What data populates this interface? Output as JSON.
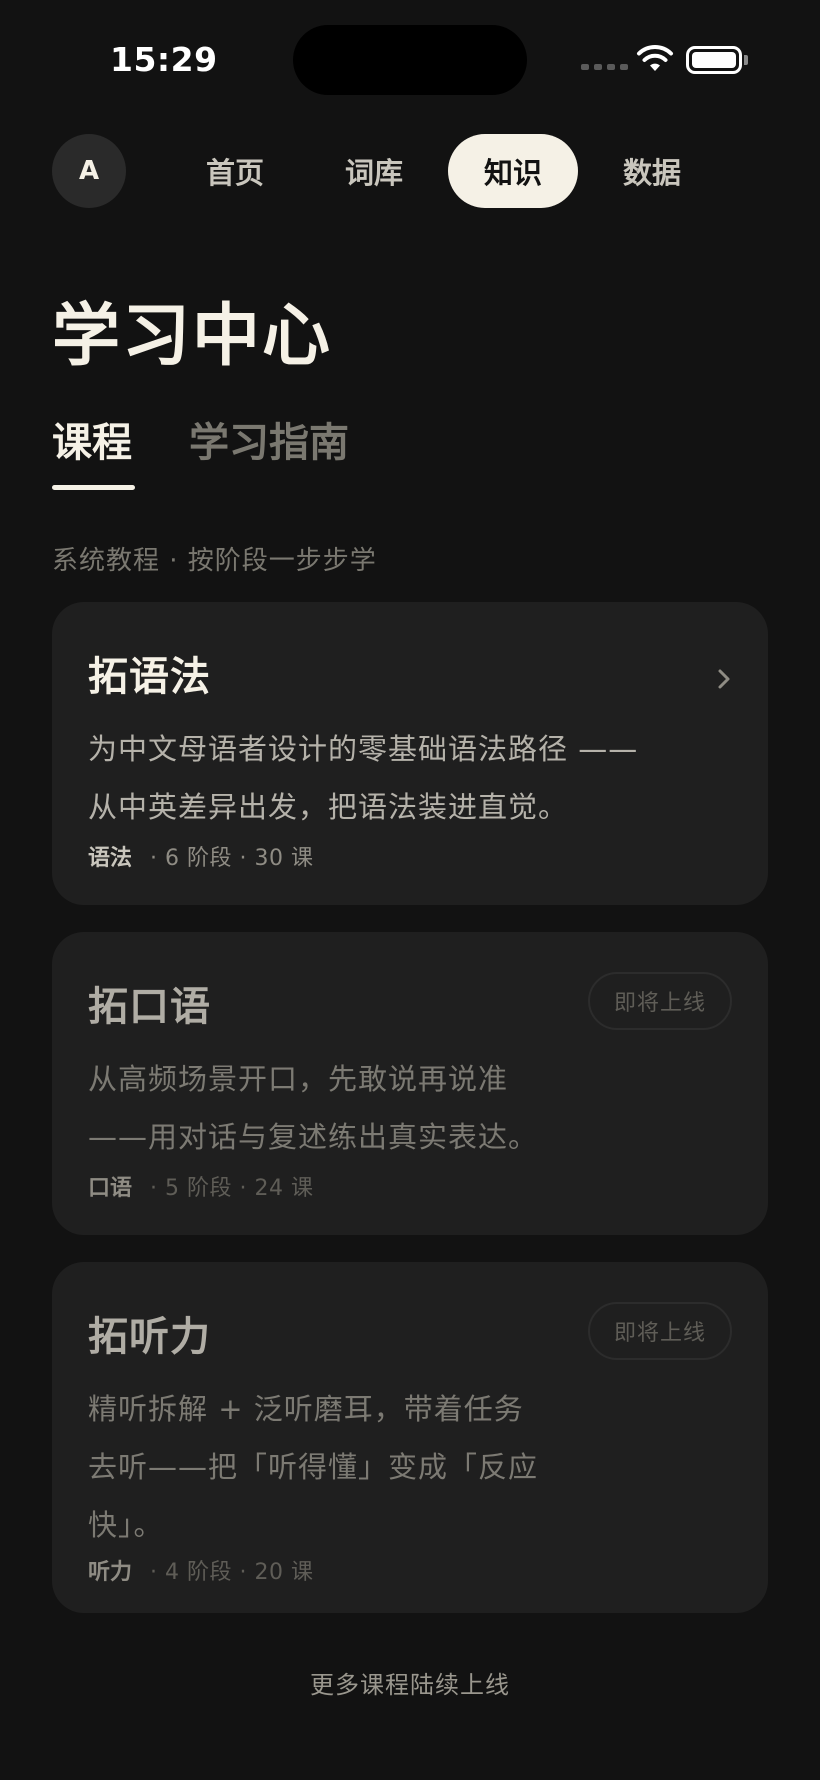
{
  "status_bar": {
    "time": "15:29"
  },
  "nav": {
    "avatar_initial": "A",
    "tabs": [
      {
        "label": "首页",
        "active": false
      },
      {
        "label": "词库",
        "active": false
      },
      {
        "label": "知识",
        "active": true
      },
      {
        "label": "数据",
        "active": false
      }
    ]
  },
  "page": {
    "title": "学习中心",
    "sub_tabs": [
      {
        "label": "课程",
        "active": true
      },
      {
        "label": "学习指南",
        "active": false
      }
    ],
    "caption": "系统教程 · 按阶段一步步学"
  },
  "courses": [
    {
      "title": "拓语法",
      "desc_lines": [
        "为中文母语者设计的零基础语法路径 ——",
        "从中英差异出发，把语法装进直觉。"
      ],
      "tag": "语法",
      "stats": "· 6 阶段 · 30 课",
      "status": "available",
      "action_icon": "chevron-right-icon"
    },
    {
      "title": "拓口语",
      "desc_lines": [
        "从高频场景开口，先敢说再说准",
        "——用对话与复述练出真实表达。"
      ],
      "tag": "口语",
      "stats": "· 5 阶段 · 24 课",
      "status": "coming_soon",
      "badge": "即将上线"
    },
    {
      "title": "拓听力",
      "desc_lines": [
        "精听拆解 + 泛听磨耳，带着任务",
        "去听——把「听得懂」变成「反应",
        "快」。"
      ],
      "tag": "听力",
      "stats": "· 4 阶段 · 20 课",
      "status": "coming_soon",
      "badge": "即将上线"
    }
  ],
  "footer_note": "更多课程陆续上线",
  "colors": {
    "background": "#121212",
    "card": "#1f1f1f",
    "accent": "#f5f1e6"
  }
}
